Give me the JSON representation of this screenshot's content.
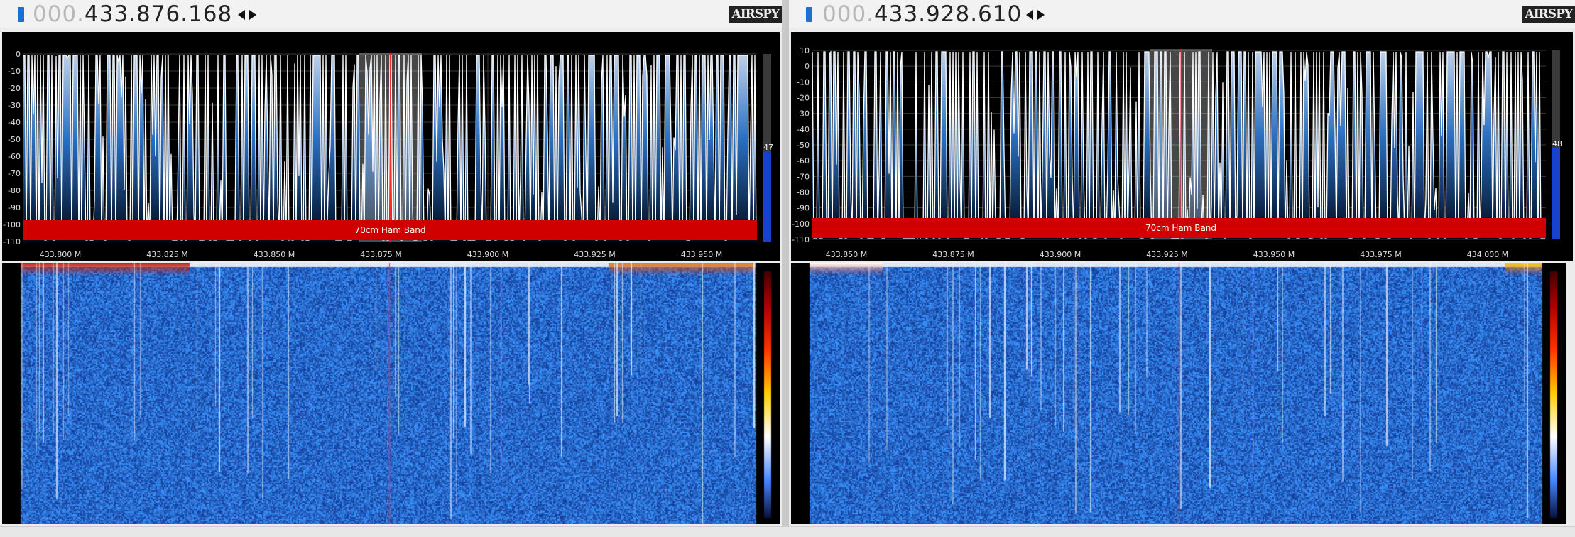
{
  "app": {
    "logo_text": "AIRSPY"
  },
  "left": {
    "frequency": {
      "lead": "000.",
      "value": "433.876.168"
    },
    "spectrum": {
      "y_ticks": [
        "0",
        "-10",
        "-20",
        "-30",
        "-40",
        "-50",
        "-60",
        "-70",
        "-80",
        "-90",
        "-100",
        "-110"
      ],
      "x_ticks": [
        "433.800 M",
        "433.825 M",
        "433.850 M",
        "433.875 M",
        "433.900 M",
        "433.925 M",
        "433.950 M"
      ],
      "band_label": "70cm Ham Band",
      "level_value": "47"
    }
  },
  "right": {
    "frequency": {
      "lead": "000.",
      "value": "433.928.610"
    },
    "spectrum": {
      "y_ticks": [
        "10",
        "0",
        "-10",
        "-20",
        "-30",
        "-40",
        "-50",
        "-60",
        "-70",
        "-80",
        "-90",
        "-100",
        "-110"
      ],
      "x_ticks": [
        "433.850 M",
        "433.875 M",
        "433.900 M",
        "433.925 M",
        "433.950 M",
        "433.975 M",
        "434.000 M"
      ],
      "band_label": "70cm Ham Band",
      "level_value": "48"
    }
  },
  "colors": {
    "accent": "#1e6fd0",
    "band": "#d00000",
    "center_line": "#ff2a2a",
    "trace": "#ffffff"
  },
  "icons": {
    "stepper": "left-right-arrows-icon"
  }
}
